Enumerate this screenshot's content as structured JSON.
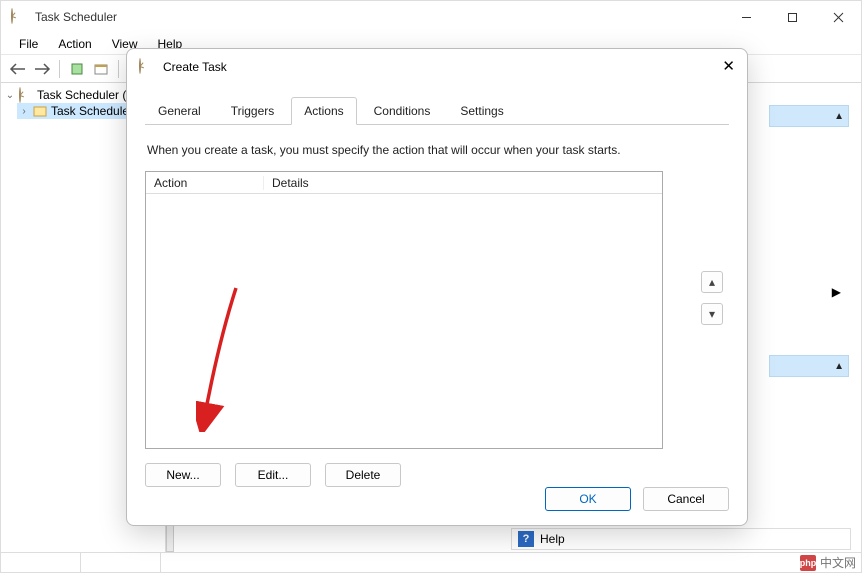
{
  "main": {
    "title": "Task Scheduler",
    "menubar": [
      "File",
      "Action",
      "View",
      "Help"
    ],
    "tree": {
      "root": "Task Scheduler (L",
      "child": "Task Schedule"
    },
    "help": "Help"
  },
  "dialog": {
    "title": "Create Task",
    "tabs": [
      "General",
      "Triggers",
      "Actions",
      "Conditions",
      "Settings"
    ],
    "active_tab": "Actions",
    "description": "When you create a task, you must specify the action that will occur when your task starts.",
    "columns": {
      "action": "Action",
      "details": "Details"
    },
    "buttons": {
      "new": "New...",
      "edit": "Edit...",
      "delete": "Delete",
      "ok": "OK",
      "cancel": "Cancel"
    }
  },
  "watermark": "中文网",
  "colors": {
    "accent": "#0067c0",
    "section": "#cfe8fb"
  }
}
